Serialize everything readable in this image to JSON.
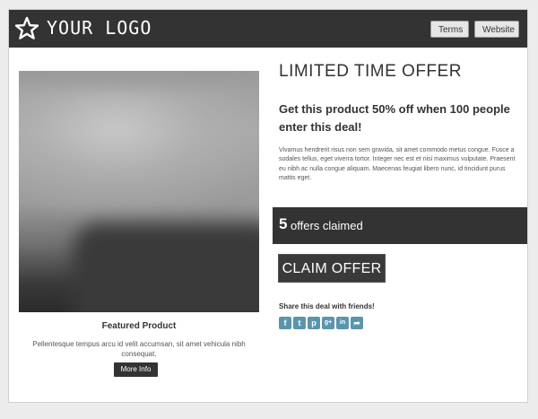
{
  "header": {
    "logo_text": "YOUR LOGO",
    "logo_icon": "star-icon",
    "terms_label": "Terms",
    "website_label": "Website"
  },
  "product": {
    "title": "Featured Product",
    "description": "Pellentesque tempus arcu id velit accumsan, sit amet vehicula nibh consequat.",
    "more_info_label": "More Info"
  },
  "offer": {
    "title": "LIMITED TIME OFFER",
    "subtitle": "Get this product 50% off when 100 people enter this deal!",
    "body": "Vivamus hendrerit risus non sem gravida, sit amet commodo metus congue. Fusce a sodales tellus, eget viverra tortor. Integer nec est et nisi maximus vulputate. Praesent eu nibh ac nulla congue aliquam. Maecenas feugiat libero nunc, id tincidunt purus mattis eget.",
    "claimed_count": "5",
    "claimed_label": "offers claimed",
    "claim_button_label": "CLAIM OFFER"
  },
  "share": {
    "title": "Share this deal with friends!",
    "icons": [
      {
        "name": "facebook-icon",
        "glyph": "f"
      },
      {
        "name": "twitter-icon",
        "glyph": "t"
      },
      {
        "name": "pinterest-icon",
        "glyph": "p"
      },
      {
        "name": "google-plus-icon",
        "glyph": "g+"
      },
      {
        "name": "linkedin-icon",
        "glyph": "in"
      },
      {
        "name": "share-icon",
        "glyph": "➦"
      }
    ]
  },
  "colors": {
    "header_bg": "#333333",
    "accent": "#5b95ad",
    "page_bg": "#ececec"
  }
}
